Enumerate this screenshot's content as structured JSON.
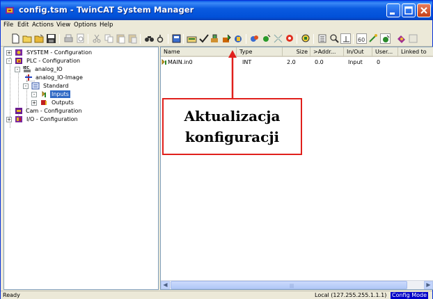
{
  "window": {
    "title": "config.tsm - TwinCAT System Manager",
    "title_color": "#ffffff",
    "icon": "twincat-app-icon"
  },
  "menu": [
    "File",
    "Edit",
    "Actions",
    "View",
    "Options",
    "Help"
  ],
  "toolbar": {
    "icons": [
      "new-icon",
      "open-icon",
      "open-folder-icon",
      "save-icon",
      "print-icon",
      "print-preview-icon",
      "cut-icon",
      "copy-icon",
      "paste-icon",
      "paste-special-icon",
      "find-icon",
      "find-next-icon",
      "append-icon",
      "insert-icon",
      "check-configuration-icon",
      "generate-mappings-icon",
      "activate-configuration-icon",
      "restart-icon",
      "reload-devices-icon",
      "scan-icon",
      "toggle-free-run-icon",
      "force-icon",
      "zoom-icon",
      "show-online-icon",
      "watch-icon",
      "toggle-icon",
      "help-icon"
    ],
    "highlighted": "generate-mappings-icon"
  },
  "tree": {
    "items": [
      {
        "label": "SYSTEM - Configuration",
        "icon": "system-config-icon",
        "expander": "+"
      },
      {
        "label": "PLC - Configuration",
        "icon": "plc-config-icon",
        "expander": "-"
      },
      {
        "label": "analog_IO",
        "icon": "iec-project-icon",
        "expander": "-"
      },
      {
        "label": "analog_IO-Image",
        "icon": "process-image-icon",
        "expander": ""
      },
      {
        "label": "Standard",
        "icon": "task-icon",
        "expander": "-"
      },
      {
        "label": "Inputs",
        "icon": "inputs-icon",
        "expander": "-",
        "selected": true
      },
      {
        "label": "Outputs",
        "icon": "outputs-icon",
        "expander": "+"
      },
      {
        "label": "Cam - Configuration",
        "icon": "cam-config-icon",
        "expander": ""
      },
      {
        "label": "I/O - Configuration",
        "icon": "io-config-icon",
        "expander": "+"
      }
    ]
  },
  "list": {
    "columns": [
      "Name",
      "Type",
      "Size",
      ">Addr...",
      "In/Out",
      "User...",
      "Linked to"
    ],
    "rows": [
      {
        "name": "MAIN.in0",
        "type": "INT",
        "size": "2.0",
        "addr": "0.0",
        "inout": "Input",
        "user": "0",
        "linked": ""
      }
    ]
  },
  "annotation": {
    "line1": "Aktualizacja",
    "line2": "konfiguracji",
    "color": "#e0201c"
  },
  "status": {
    "left": "Ready",
    "local": "Local (127.255.255.1.1.1)",
    "mode": "Config Mode",
    "mode_color": "#0000c8"
  }
}
